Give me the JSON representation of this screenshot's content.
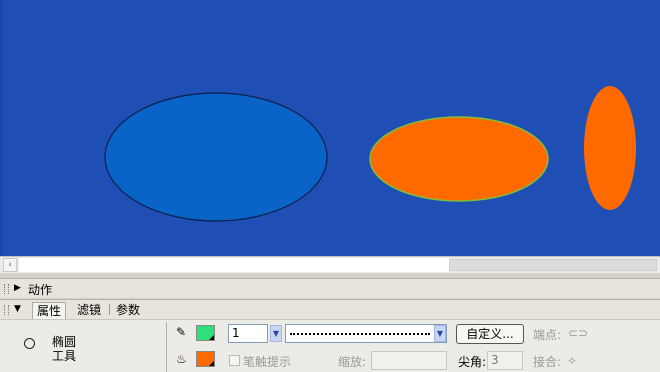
{
  "stage": {
    "background": "#1f4fb5",
    "shapes": [
      {
        "name": "blue-ellipse",
        "fill": "#0a63c6",
        "stroke": "#0b1f4a"
      },
      {
        "name": "orange-ellipse-wide",
        "fill": "#ff6a00",
        "stroke": "#7fbf3a"
      },
      {
        "name": "orange-ellipse-tall",
        "fill": "#ff6a00",
        "stroke": "none"
      }
    ]
  },
  "scrollbar": {
    "left_arrow": "‹"
  },
  "actions_panel": {
    "title": "动作",
    "collapse_icon": "▶"
  },
  "property_panel": {
    "collapse_icon": "▼",
    "tabs": [
      {
        "label": "属性"
      },
      {
        "label": "滤镜"
      },
      {
        "label": "参数"
      }
    ]
  },
  "properties": {
    "tool_name_line1": "椭圆",
    "tool_name_line2": "工具",
    "stroke_color": "#2fe07a",
    "fill_color": "#ff6a00",
    "stroke_width": "1",
    "custom_button": "自定义...",
    "endpoint_label": "端点:",
    "hinting_label": "笔触提示",
    "scale_label": "缩放:",
    "miter_label": "尖角:",
    "miter_value": "3",
    "join_label": "接合:"
  }
}
